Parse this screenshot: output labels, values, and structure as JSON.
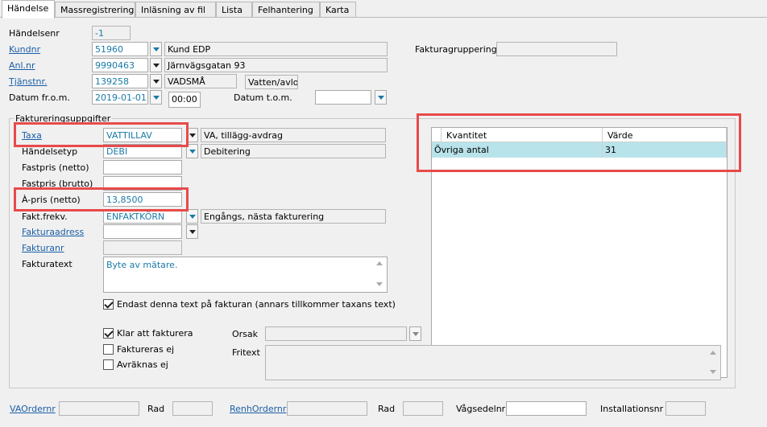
{
  "tabs": [
    {
      "label": "Händelse",
      "active": true
    },
    {
      "label": "Massregistrering"
    },
    {
      "label": "Inläsning av fil"
    },
    {
      "label": "Lista"
    },
    {
      "label": "Felhantering"
    },
    {
      "label": "Karta"
    }
  ],
  "header": {
    "handelsenr_label": "Händelsenr",
    "handelsenr_value": "-1",
    "kundnr_label": "Kundnr",
    "kundnr_value": "51960",
    "kundnr_name": "Kund EDP",
    "anlnr_label": "Anl.nr",
    "anlnr_value": "9990463",
    "anlnr_address": "Järnvägsgatan 93",
    "tjanstnr_label": "Tjänstnr.",
    "tjanstnr_value": "139258",
    "tjanstnr_area": "VADSMÅ",
    "tjanstnr_type": "Vatten/avlop",
    "datum_from_label": "Datum fr.o.m.",
    "datum_from_value": "2019-01-01",
    "time_value": "00:00",
    "datum_tom_label": "Datum t.o.m.",
    "datum_tom_value": "",
    "fakturagruppering_label": "Fakturagruppering",
    "fakturagruppering_value": ""
  },
  "billing": {
    "group_title": "Faktureringsuppgifter",
    "taxa_label": "Taxa",
    "taxa_value": "VATTILLAV",
    "taxa_desc": "VA, tillägg-avdrag",
    "handelsetyp_label": "Händelsetyp",
    "handelsetyp_value": "DEBI",
    "handelsetyp_desc": "Debitering",
    "fastpris_netto_label": "Fastpris (netto)",
    "fastpris_netto_value": "",
    "fastpris_brutto_label": "Fastpris (brutto)",
    "fastpris_brutto_value": "",
    "apris_label": "À-pris (netto)",
    "apris_value": "13,8500",
    "faktfrekv_label": "Fakt.frekv.",
    "faktfrekv_value": "ENFAKTKÖRN",
    "faktfrekv_desc": "Engångs, nästa fakturering",
    "fakturaadress_label": "Fakturaadress",
    "fakturaadress_value": "",
    "fakturanr_label": "Fakturanr",
    "fakturanr_value": "",
    "fakturatext_label": "Fakturatext",
    "fakturatext_value": "Byte av mätare.",
    "endast_label": "Endast denna text på fakturan (annars tillkommer taxans text)",
    "endast_checked": true
  },
  "grid": {
    "col_kvantitet": "Kvantitet",
    "col_varde": "Värde",
    "rows": [
      {
        "kvantitet": "Övriga antal",
        "varde": "31"
      }
    ]
  },
  "status": {
    "klar_label": "Klar att fakturera",
    "klar_checked": true,
    "faktureras_ej_label": "Faktureras ej",
    "faktureras_ej_checked": false,
    "avraknas_ej_label": "Avräknas ej",
    "avraknas_ej_checked": false,
    "orsak_label": "Orsak",
    "orsak_value": "",
    "fritext_label": "Fritext",
    "fritext_value": ""
  },
  "footer": {
    "vaordernr_label": "VAOrdernr",
    "rad1_label": "Rad",
    "renhordernr_label": "RenhOrdernr",
    "rad2_label": "Rad",
    "vagsedelnr_label": "Vågsedelnr",
    "installationsnr_label": "Installationsnr"
  },
  "colors": {
    "link": "#1a5fa8",
    "teal_value": "#1a7aa8",
    "highlight": "#e84a4a",
    "row_selected": "#b9e3ea"
  }
}
